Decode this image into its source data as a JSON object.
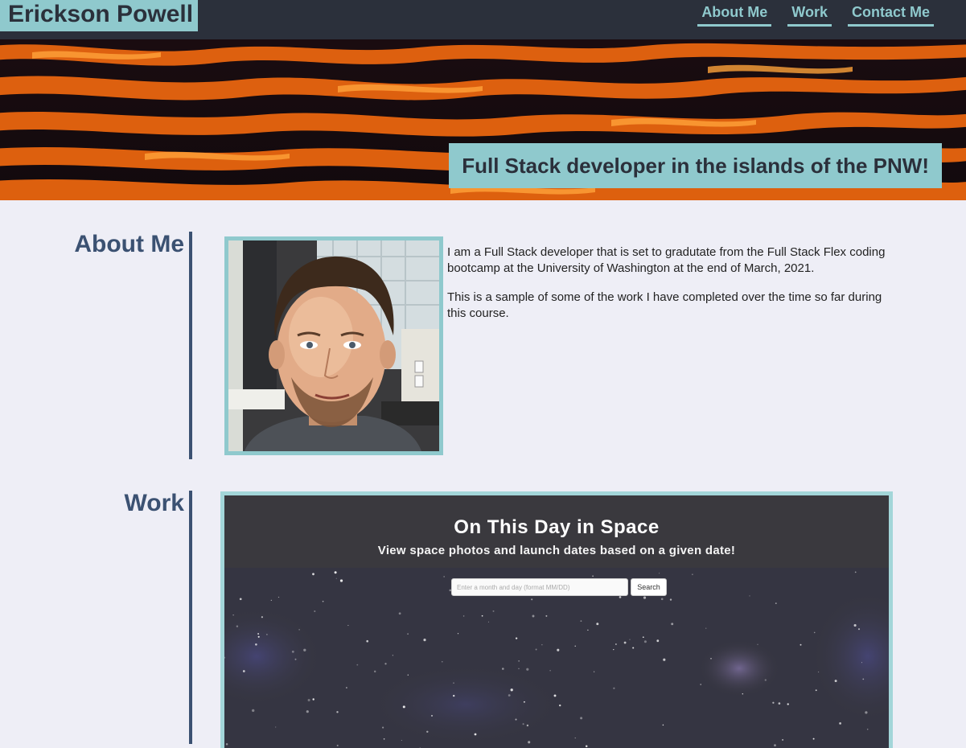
{
  "header": {
    "site_title": "Erickson Powell",
    "nav": [
      {
        "label": "About Me"
      },
      {
        "label": "Work"
      },
      {
        "label": "Contact Me"
      }
    ]
  },
  "hero": {
    "tagline": "Full Stack developer in the islands of the PNW!"
  },
  "about": {
    "heading": "About Me",
    "paragraphs": [
      "I am a Full Stack developer that is set to gradutate from the Full Stack Flex coding bootcamp at the University of Washington at the end of March, 2021.",
      "This is a sample of some of the work I have completed over the time so far during this course."
    ]
  },
  "work": {
    "heading": "Work",
    "project": {
      "title": "On This Day in Space",
      "subtitle": "View space photos and launch dates based on a given date!",
      "search_placeholder": "Enter a month and day (format MM/DD)",
      "search_button": "Search"
    }
  },
  "colors": {
    "header_bg": "#2b303b",
    "accent": "#8fc9cd",
    "heading": "#3b5172",
    "page_bg": "#eeeef6"
  }
}
